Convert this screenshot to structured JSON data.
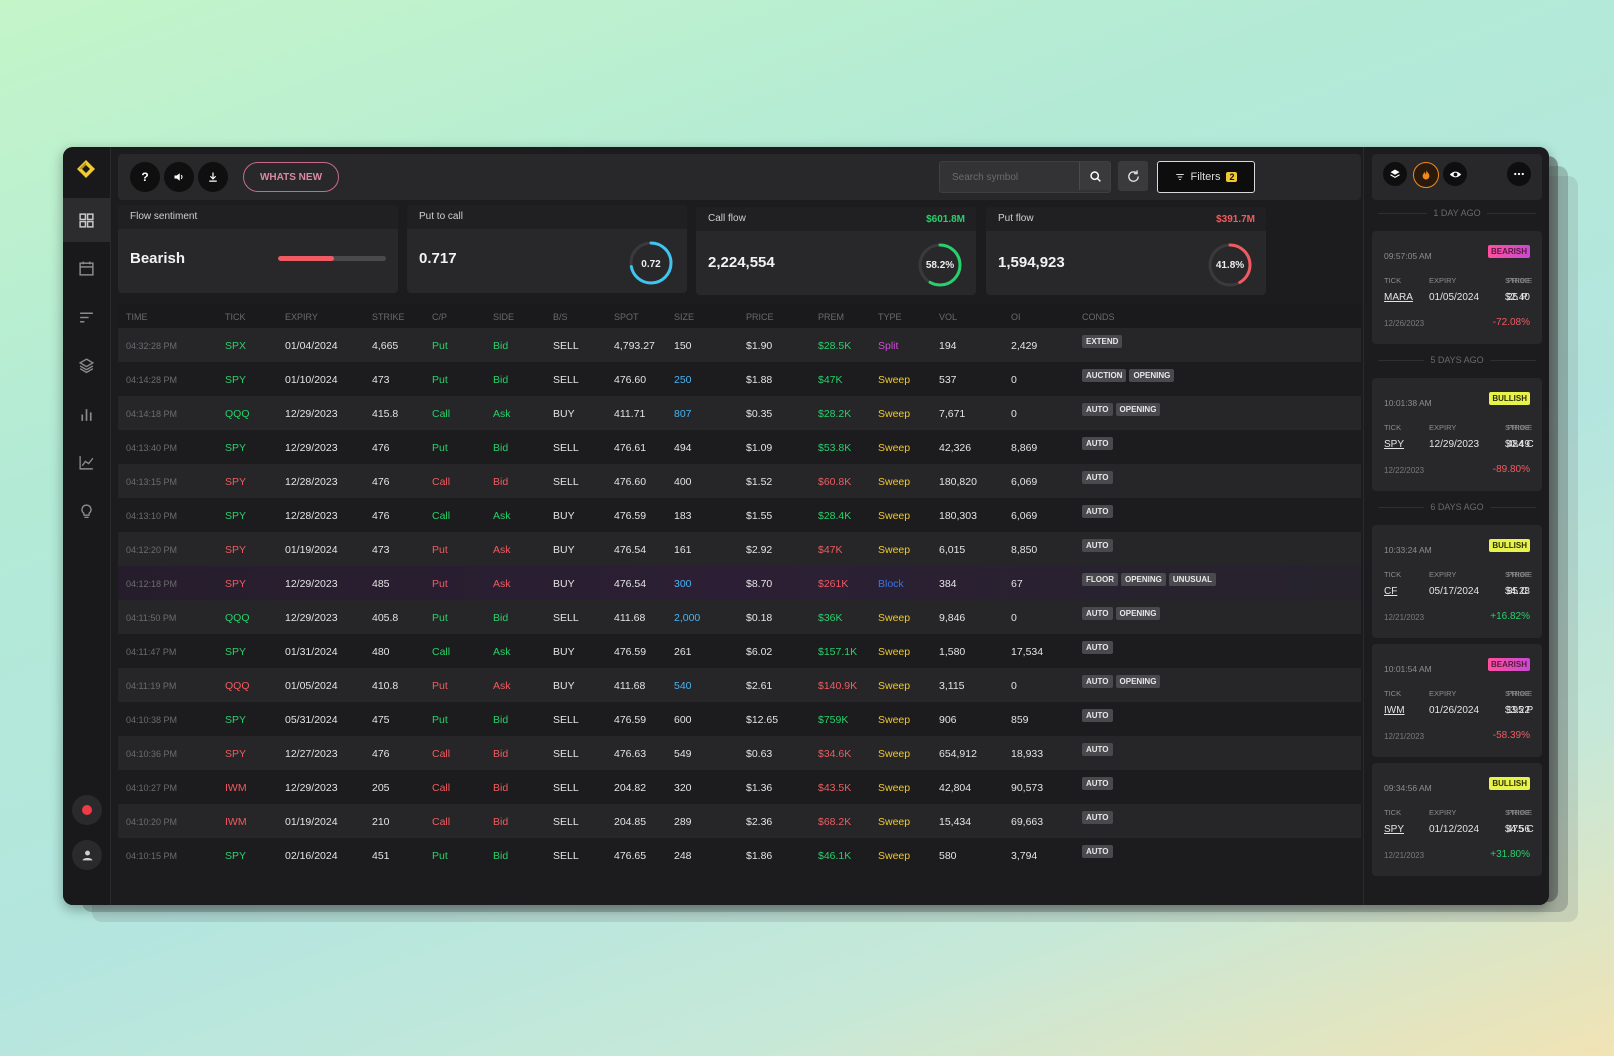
{
  "toolbar": {
    "help_label": "?",
    "whats_new_label": "WHATS NEW",
    "search_placeholder": "Search symbol",
    "filters_label": "Filters",
    "filters_count": "2"
  },
  "cards": {
    "sentiment": {
      "label": "Flow sentiment",
      "value": "Bearish",
      "bar_fill_percent": 52
    },
    "put_to_call": {
      "label": "Put to call",
      "value": "0.717",
      "gauge_text": "0.72",
      "gauge_fraction": 0.72,
      "gauge_color": "#3ec6f0"
    },
    "call_flow": {
      "label": "Call flow",
      "amount": "$601.8M",
      "value": "2,224,554",
      "gauge_text": "58.2%",
      "gauge_fraction": 0.582,
      "gauge_color": "#27d06a"
    },
    "put_flow": {
      "label": "Put flow",
      "amount": "$391.7M",
      "value": "1,594,923",
      "gauge_text": "41.8%",
      "gauge_fraction": 0.418,
      "gauge_color": "#f05b60"
    }
  },
  "table": {
    "headers": [
      "TIME",
      "TICK",
      "EXPIRY",
      "STRIKE",
      "C/P",
      "SIDE",
      "B/S",
      "SPOT",
      "SIZE",
      "PRICE",
      "PREM",
      "TYPE",
      "VOL",
      "OI",
      "CONDS"
    ],
    "rows": [
      {
        "time": "04:32:28 PM",
        "tick": "SPX",
        "expiry": "01/04/2024",
        "strike": "4,665",
        "cp": "Put",
        "side": "Bid",
        "bs": "SELL",
        "spot": "4,793.27",
        "size": "150",
        "price": "$1.90",
        "prem": "$28.5K",
        "type": "Split",
        "vol": "194",
        "oi": "2,429",
        "conds": [
          "EXTEND"
        ],
        "sentiment": "bull",
        "size_hl": false,
        "highlight": false
      },
      {
        "time": "04:14:28 PM",
        "tick": "SPY",
        "expiry": "01/10/2024",
        "strike": "473",
        "cp": "Put",
        "side": "Bid",
        "bs": "SELL",
        "spot": "476.60",
        "size": "250",
        "price": "$1.88",
        "prem": "$47K",
        "type": "Sweep",
        "vol": "537",
        "oi": "0",
        "conds": [
          "AUCTION",
          "OPENING"
        ],
        "sentiment": "bull",
        "size_hl": true,
        "highlight": false
      },
      {
        "time": "04:14:18 PM",
        "tick": "QQQ",
        "expiry": "12/29/2023",
        "strike": "415.8",
        "cp": "Call",
        "side": "Ask",
        "bs": "BUY",
        "spot": "411.71",
        "size": "807",
        "price": "$0.35",
        "prem": "$28.2K",
        "type": "Sweep",
        "vol": "7,671",
        "oi": "0",
        "conds": [
          "AUTO",
          "OPENING"
        ],
        "sentiment": "bull",
        "size_hl": true,
        "highlight": false
      },
      {
        "time": "04:13:40 PM",
        "tick": "SPY",
        "expiry": "12/29/2023",
        "strike": "476",
        "cp": "Put",
        "side": "Bid",
        "bs": "SELL",
        "spot": "476.61",
        "size": "494",
        "price": "$1.09",
        "prem": "$53.8K",
        "type": "Sweep",
        "vol": "42,326",
        "oi": "8,869",
        "conds": [
          "AUTO"
        ],
        "sentiment": "bull",
        "size_hl": false,
        "highlight": false
      },
      {
        "time": "04:13:15 PM",
        "tick": "SPY",
        "expiry": "12/28/2023",
        "strike": "476",
        "cp": "Call",
        "side": "Bid",
        "bs": "SELL",
        "spot": "476.60",
        "size": "400",
        "price": "$1.52",
        "prem": "$60.8K",
        "type": "Sweep",
        "vol": "180,820",
        "oi": "6,069",
        "conds": [
          "AUTO"
        ],
        "sentiment": "bear",
        "size_hl": false,
        "highlight": false
      },
      {
        "time": "04:13:10 PM",
        "tick": "SPY",
        "expiry": "12/28/2023",
        "strike": "476",
        "cp": "Call",
        "side": "Ask",
        "bs": "BUY",
        "spot": "476.59",
        "size": "183",
        "price": "$1.55",
        "prem": "$28.4K",
        "type": "Sweep",
        "vol": "180,303",
        "oi": "6,069",
        "conds": [
          "AUTO"
        ],
        "sentiment": "bull",
        "size_hl": false,
        "highlight": false
      },
      {
        "time": "04:12:20 PM",
        "tick": "SPY",
        "expiry": "01/19/2024",
        "strike": "473",
        "cp": "Put",
        "side": "Ask",
        "bs": "BUY",
        "spot": "476.54",
        "size": "161",
        "price": "$2.92",
        "prem": "$47K",
        "type": "Sweep",
        "vol": "6,015",
        "oi": "8,850",
        "conds": [
          "AUTO"
        ],
        "sentiment": "bear",
        "size_hl": false,
        "highlight": false
      },
      {
        "time": "04:12:18 PM",
        "tick": "SPY",
        "expiry": "12/29/2023",
        "strike": "485",
        "cp": "Put",
        "side": "Ask",
        "bs": "BUY",
        "spot": "476.54",
        "size": "300",
        "price": "$8.70",
        "prem": "$261K",
        "type": "Block",
        "vol": "384",
        "oi": "67",
        "conds": [
          "FLOOR",
          "OPENING",
          "UNUSUAL"
        ],
        "sentiment": "bear",
        "size_hl": true,
        "highlight": true
      },
      {
        "time": "04:11:50 PM",
        "tick": "QQQ",
        "expiry": "12/29/2023",
        "strike": "405.8",
        "cp": "Put",
        "side": "Bid",
        "bs": "SELL",
        "spot": "411.68",
        "size": "2,000",
        "price": "$0.18",
        "prem": "$36K",
        "type": "Sweep",
        "vol": "9,846",
        "oi": "0",
        "conds": [
          "AUTO",
          "OPENING"
        ],
        "sentiment": "bull",
        "size_hl": true,
        "highlight": false
      },
      {
        "time": "04:11:47 PM",
        "tick": "SPY",
        "expiry": "01/31/2024",
        "strike": "480",
        "cp": "Call",
        "side": "Ask",
        "bs": "BUY",
        "spot": "476.59",
        "size": "261",
        "price": "$6.02",
        "prem": "$157.1K",
        "type": "Sweep",
        "vol": "1,580",
        "oi": "17,534",
        "conds": [
          "AUTO"
        ],
        "sentiment": "bull",
        "size_hl": false,
        "highlight": false
      },
      {
        "time": "04:11:19 PM",
        "tick": "QQQ",
        "expiry": "01/05/2024",
        "strike": "410.8",
        "cp": "Put",
        "side": "Ask",
        "bs": "BUY",
        "spot": "411.68",
        "size": "540",
        "price": "$2.61",
        "prem": "$140.9K",
        "type": "Sweep",
        "vol": "3,115",
        "oi": "0",
        "conds": [
          "AUTO",
          "OPENING"
        ],
        "sentiment": "bear",
        "size_hl": true,
        "highlight": false
      },
      {
        "time": "04:10:38 PM",
        "tick": "SPY",
        "expiry": "05/31/2024",
        "strike": "475",
        "cp": "Put",
        "side": "Bid",
        "bs": "SELL",
        "spot": "476.59",
        "size": "600",
        "price": "$12.65",
        "prem": "$759K",
        "type": "Sweep",
        "vol": "906",
        "oi": "859",
        "conds": [
          "AUTO"
        ],
        "sentiment": "bull",
        "size_hl": false,
        "highlight": false
      },
      {
        "time": "04:10:36 PM",
        "tick": "SPY",
        "expiry": "12/27/2023",
        "strike": "476",
        "cp": "Call",
        "side": "Bid",
        "bs": "SELL",
        "spot": "476.63",
        "size": "549",
        "price": "$0.63",
        "prem": "$34.6K",
        "type": "Sweep",
        "vol": "654,912",
        "oi": "18,933",
        "conds": [
          "AUTO"
        ],
        "sentiment": "bear",
        "size_hl": false,
        "highlight": false
      },
      {
        "time": "04:10:27 PM",
        "tick": "IWM",
        "expiry": "12/29/2023",
        "strike": "205",
        "cp": "Call",
        "side": "Bid",
        "bs": "SELL",
        "spot": "204.82",
        "size": "320",
        "price": "$1.36",
        "prem": "$43.5K",
        "type": "Sweep",
        "vol": "42,804",
        "oi": "90,573",
        "conds": [
          "AUTO"
        ],
        "sentiment": "bear",
        "size_hl": false,
        "highlight": false
      },
      {
        "time": "04:10:20 PM",
        "tick": "IWM",
        "expiry": "01/19/2024",
        "strike": "210",
        "cp": "Call",
        "side": "Bid",
        "bs": "SELL",
        "spot": "204.85",
        "size": "289",
        "price": "$2.36",
        "prem": "$68.2K",
        "type": "Sweep",
        "vol": "15,434",
        "oi": "69,663",
        "conds": [
          "AUTO"
        ],
        "sentiment": "bear",
        "size_hl": false,
        "highlight": false
      },
      {
        "time": "04:10:15 PM",
        "tick": "SPY",
        "expiry": "02/16/2024",
        "strike": "451",
        "cp": "Put",
        "side": "Bid",
        "bs": "SELL",
        "spot": "476.65",
        "size": "248",
        "price": "$1.86",
        "prem": "$46.1K",
        "type": "Sweep",
        "vol": "580",
        "oi": "3,794",
        "conds": [
          "AUTO"
        ],
        "sentiment": "bull",
        "size_hl": false,
        "highlight": false
      }
    ]
  },
  "alerts": {
    "headers": {
      "tick": "TICK",
      "expiry": "EXPIRY",
      "strike": "STRIKE",
      "price": "PRICE"
    },
    "groups": [
      {
        "label": "1 DAY AGO",
        "items": [
          {
            "time": "09:57:05 AM",
            "badge": "BEARISH",
            "tick": "MARA",
            "expiry": "01/05/2024",
            "strike": "25 P",
            "price": "$2.40",
            "date": "12/26/2023",
            "pct": "-72.08%"
          }
        ]
      },
      {
        "label": "5 DAYS AGO",
        "items": [
          {
            "time": "10:01:38 AM",
            "badge": "BULLISH",
            "tick": "SPY",
            "expiry": "12/29/2023",
            "strike": "484 C",
            "price": "$0.49",
            "date": "12/22/2023",
            "pct": "-89.80%"
          }
        ]
      },
      {
        "label": "6 DAYS AGO",
        "items": [
          {
            "time": "10:33:24 AM",
            "badge": "BULLISH",
            "tick": "CF",
            "expiry": "05/17/2024",
            "strike": "85 C",
            "price": "$4.28",
            "date": "12/21/2023",
            "pct": "+16.82%"
          },
          {
            "time": "10:01:54 AM",
            "badge": "BEARISH",
            "tick": "IWM",
            "expiry": "01/26/2024",
            "strike": "195 P",
            "price": "$3.22",
            "date": "12/21/2023",
            "pct": "-58.39%"
          },
          {
            "time": "09:34:56 AM",
            "badge": "BULLISH",
            "tick": "SPY",
            "expiry": "01/12/2024",
            "strike": "475 C",
            "price": "$4.56",
            "date": "12/21/2023",
            "pct": "+31.80%"
          }
        ]
      }
    ]
  },
  "colors": {
    "bull": "#27d06a",
    "bear": "#f05b60",
    "accent": "#f0c933",
    "sweep": "#f0c933",
    "split": "#d04cd8",
    "block": "#3a74e0"
  },
  "icons": [
    "logo-icon",
    "dashboard-icon",
    "calendar-icon",
    "sort-icon",
    "layers-icon",
    "bar-chart-icon",
    "line-chart-icon",
    "lightbulb-icon",
    "record-icon",
    "user-icon",
    "sound-icon",
    "download-icon",
    "search-icon",
    "refresh-icon",
    "filter-icon",
    "fire-icon",
    "eye-icon",
    "more-icon"
  ]
}
